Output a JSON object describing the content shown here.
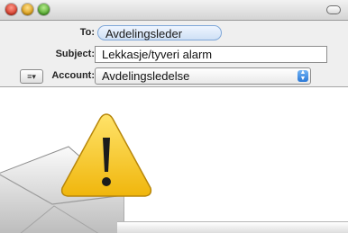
{
  "window": {
    "controls": {
      "close_icon": "close-icon",
      "minimize_icon": "minimize-icon",
      "zoom_icon": "zoom-icon",
      "toolbar_toggle_icon": "toolbar-toggle-icon"
    }
  },
  "header": {
    "to": {
      "label": "To:",
      "recipient": "Avdelingsleder"
    },
    "subject": {
      "label": "Subject:",
      "value": "Lekkasje/tyveri alarm"
    },
    "account": {
      "label": "Account:",
      "selected": "Avdelingsledelse",
      "list_button_glyph": "≡▾"
    }
  },
  "overlay": {
    "warning_icon": "warning-icon",
    "envelope_icon": "envelope-icon"
  },
  "colors": {
    "token_border": "#7fa7d8",
    "select_arrow": "#2a78d6",
    "warning_yellow": "#f6c21a"
  }
}
